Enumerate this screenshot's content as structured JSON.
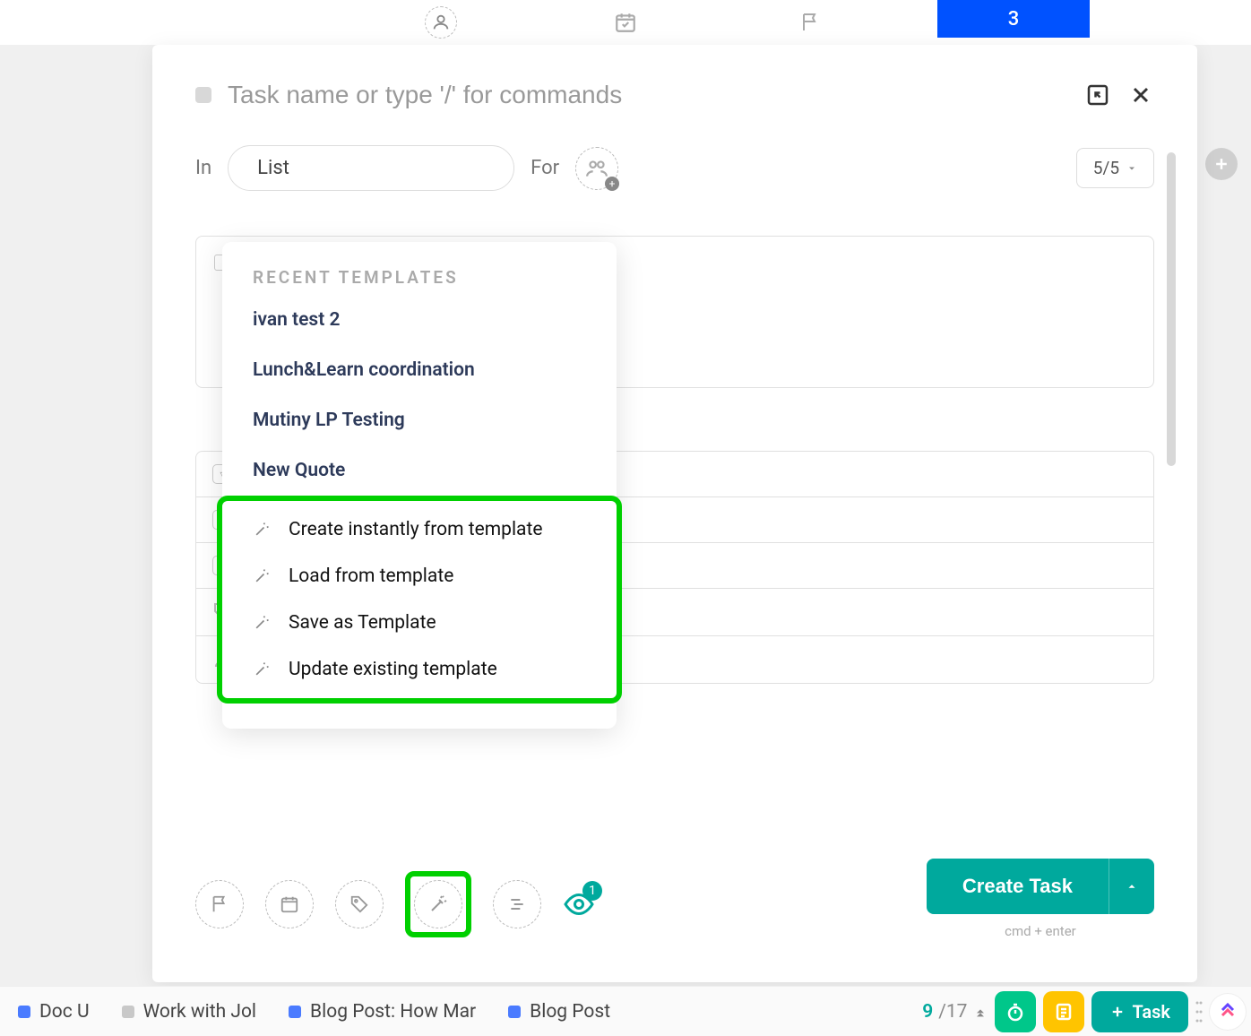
{
  "top_tab_number": "3",
  "modal": {
    "task_name_placeholder": "Task name or type '/' for commands",
    "in_label": "In",
    "list_label": "List",
    "for_label": "For",
    "ratio_label": "5/5",
    "create_button": "Create Task",
    "cmd_hint": "cmd + enter"
  },
  "templates_popup": {
    "recent_header": "RECENT TEMPLATES",
    "recent_items": [
      "ivan test 2",
      "Lunch&Learn coordination",
      "Mutiny LP Testing",
      "New Quote"
    ],
    "actions": [
      "Create instantly from template",
      "Load from template",
      "Save as Template",
      "Update existing template"
    ]
  },
  "eye_count": "1",
  "taskbar": {
    "items": [
      {
        "label": "Doc U",
        "color": "#4a7bff"
      },
      {
        "label": "Work with Jol",
        "color": "#c8c8c8"
      },
      {
        "label": "Blog Post: How Mar",
        "color": "#4a7bff"
      },
      {
        "label": "Blog Post",
        "color": "#4a7bff"
      }
    ],
    "count_open": "9",
    "count_total": "/17",
    "task_btn": "Task"
  },
  "colors": {
    "highlight_green": "#00d000",
    "teal": "#00a99d",
    "blue": "#0052ff"
  }
}
